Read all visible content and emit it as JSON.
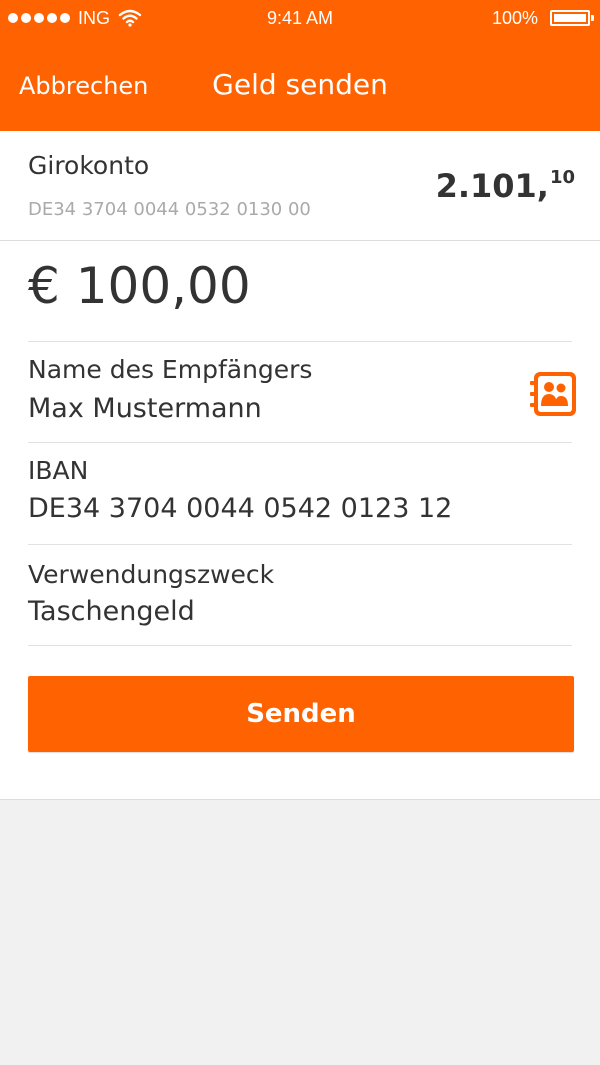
{
  "status_bar": {
    "carrier": "ING",
    "time": "9:41 AM",
    "battery": "100%"
  },
  "nav": {
    "cancel_label": "Abbrechen",
    "title": "Geld senden"
  },
  "account": {
    "name": "Girokonto",
    "iban": "DE34 3704 0044 0532 0130 00",
    "balance_main": "2.101,",
    "balance_cents": "10"
  },
  "transfer": {
    "amount": "€ 100,00",
    "recipient_label": "Name des Empfängers",
    "recipient_value": "Max Mustermann",
    "iban_label": "IBAN",
    "iban_value": "DE34 3704 0044 0542 0123 12",
    "purpose_label": "Verwendungszweck",
    "purpose_value": "Taschengeld"
  },
  "send_label": "Senden",
  "icons": {
    "contacts": "contacts-book-icon",
    "wifi": "wifi-icon",
    "battery": "battery-icon",
    "signal": "signal-icon"
  },
  "colors": {
    "brand": "#ff6200",
    "text": "#333333",
    "muted": "#aaaaaa"
  }
}
